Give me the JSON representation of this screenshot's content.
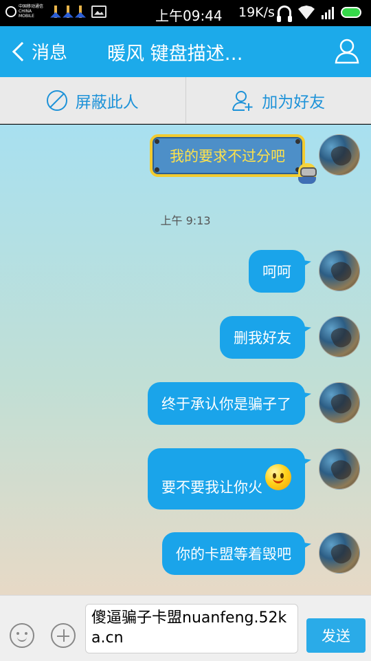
{
  "status_bar": {
    "carrier": "中国移动通信 CHINA MOBILE",
    "time": "上午09:44",
    "speed": "19K/s"
  },
  "header": {
    "back_label": "消息",
    "title": "暖风 键盘描述…",
    "profile_icon": "person-icon"
  },
  "action_bar": {
    "block_label": "屏蔽此人",
    "add_friend_label": "加为好友"
  },
  "messages": [
    {
      "text": "我的要求不过分吧",
      "style": "minion-bubble"
    },
    {
      "timestamp": "上午 9:13"
    },
    {
      "text": "呵呵"
    },
    {
      "text": "删我好友"
    },
    {
      "text": "终于承认你是骗子了"
    },
    {
      "text": "要不要我让你火",
      "emoji": "smiley-icon"
    },
    {
      "text": "你的卡盟等着毁吧"
    }
  ],
  "input": {
    "value": "傻逼骗子卡盟nuanfeng.52ka.cn",
    "send_label": "发送"
  },
  "colors": {
    "header": "#1caaea",
    "bubble": "#1aa4ea",
    "action_text": "#1d92d8"
  }
}
